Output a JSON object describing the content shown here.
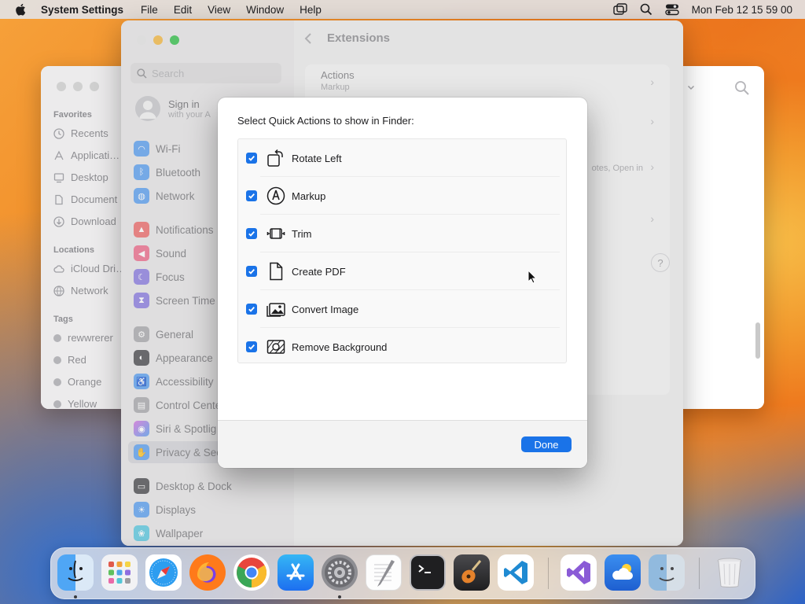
{
  "menubar": {
    "app_name": "System Settings",
    "menus": [
      "File",
      "Edit",
      "View",
      "Window",
      "Help"
    ],
    "clock": "Mon Feb 12  15 59 00"
  },
  "finder": {
    "favorites_head": "Favorites",
    "favorites": [
      "Recents",
      "Applicati…",
      "Desktop",
      "Document",
      "Download"
    ],
    "locations_head": "Locations",
    "locations": [
      "iCloud Dri…",
      "Network"
    ],
    "tags_head": "Tags",
    "tags": [
      "rewwrerer",
      "Red",
      "Orange",
      "Yellow"
    ]
  },
  "settings": {
    "title": "Extensions",
    "search_placeholder": "Search",
    "signin_title": "Sign in",
    "signin_sub": "with your A",
    "sidebar": [
      "Wi-Fi",
      "Bluetooth",
      "Network",
      "Notifications",
      "Sound",
      "Focus",
      "Screen Time",
      "General",
      "Appearance",
      "Accessibility",
      "Control Cente",
      "Siri & Spotlig",
      "Privacy & Sec",
      "Desktop & Dock",
      "Displays",
      "Wallpaper"
    ],
    "rows": [
      {
        "title": "Actions",
        "subtitle": "Markup"
      },
      {
        "title": "",
        "subtitle": "otes, Open in"
      }
    ],
    "help": "?"
  },
  "sheet": {
    "heading": "Select Quick Actions to show in Finder:",
    "actions": [
      {
        "label": "Rotate Left",
        "icon": "rotate-left-icon",
        "checked": true
      },
      {
        "label": "Markup",
        "icon": "markup-icon",
        "checked": true
      },
      {
        "label": "Trim",
        "icon": "trim-icon",
        "checked": true
      },
      {
        "label": "Create PDF",
        "icon": "create-pdf-icon",
        "checked": true
      },
      {
        "label": "Convert Image",
        "icon": "convert-image-icon",
        "checked": true
      },
      {
        "label": "Remove Background",
        "icon": "remove-background-icon",
        "checked": true
      }
    ],
    "done_label": "Done"
  },
  "dock": {
    "apps": [
      "Finder",
      "Launchpad",
      "Safari",
      "Firefox",
      "Chrome",
      "App Store",
      "System Settings",
      "TextEdit",
      "Terminal",
      "GarageBand",
      "VS Code",
      "Visual Studio",
      "Weather",
      "Finder Alt",
      "Trash"
    ]
  },
  "colors": {
    "accent": "#1a73e8"
  }
}
